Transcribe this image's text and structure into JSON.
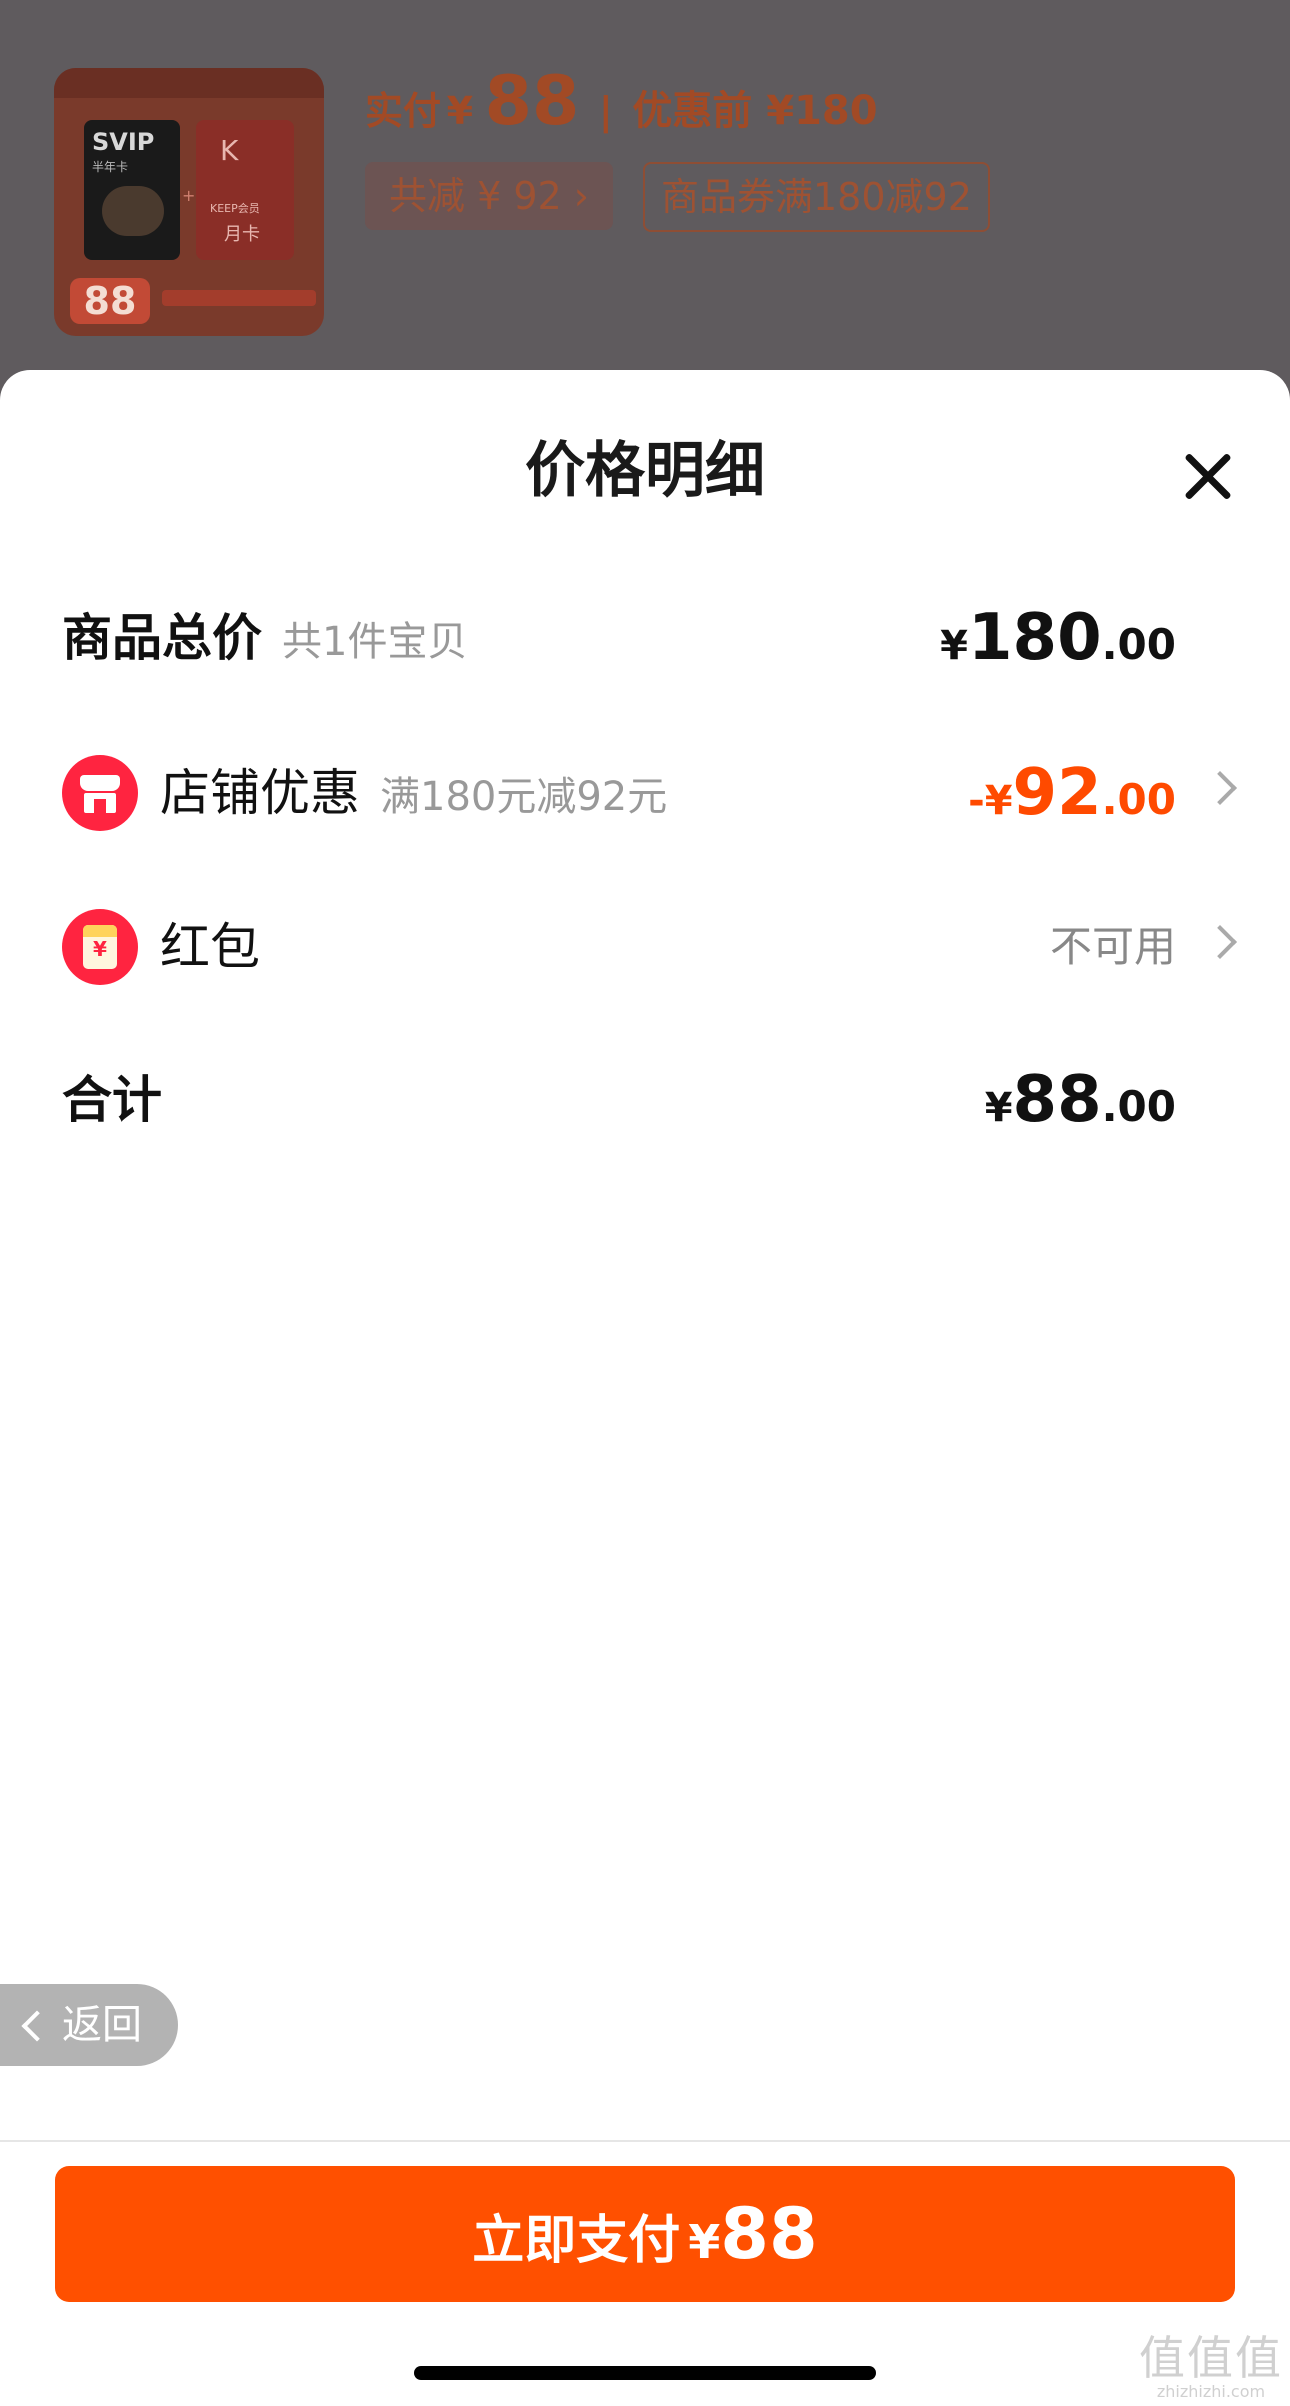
{
  "product": {
    "pay_label": "实付",
    "pay_currency": "¥",
    "pay_amount": "88",
    "separator": "|",
    "before_price": "优惠前 ¥180",
    "saving_tag": "共减 ¥ 92 ›",
    "coupon_tag": "商品券满180减92",
    "thumb_card1_title": "SVIP",
    "thumb_card1_sub": "半年卡",
    "thumb_card2_logo": "K",
    "thumb_card2_text": "KEEP会员",
    "thumb_card2_month": "月卡",
    "thumb_price": "88"
  },
  "sheet": {
    "title": "价格明细",
    "rows": [
      {
        "label": "商品总价",
        "sub": "共1件宝贝",
        "currency": "¥",
        "int": "180",
        "dec": ".00"
      },
      {
        "label": "店铺优惠",
        "sub": "满180元减92元",
        "prefix": "-",
        "currency": "¥",
        "int": "92",
        "dec": ".00",
        "icon": "shop-icon"
      },
      {
        "label": "红包",
        "value": "不可用",
        "icon": "red-envelope-icon"
      },
      {
        "label": "合计",
        "currency": "¥",
        "int": "88",
        "dec": ".00"
      }
    ]
  },
  "back": {
    "label": "返回"
  },
  "pay_button": {
    "label": "立即支付",
    "currency": "¥",
    "amount": "88"
  },
  "watermark": {
    "glyph": "值值值",
    "url": "zhizhizhi.com"
  },
  "colors": {
    "accent": "#ff5000",
    "discount": "#ff4a00",
    "icon_red": "#ff2440"
  }
}
